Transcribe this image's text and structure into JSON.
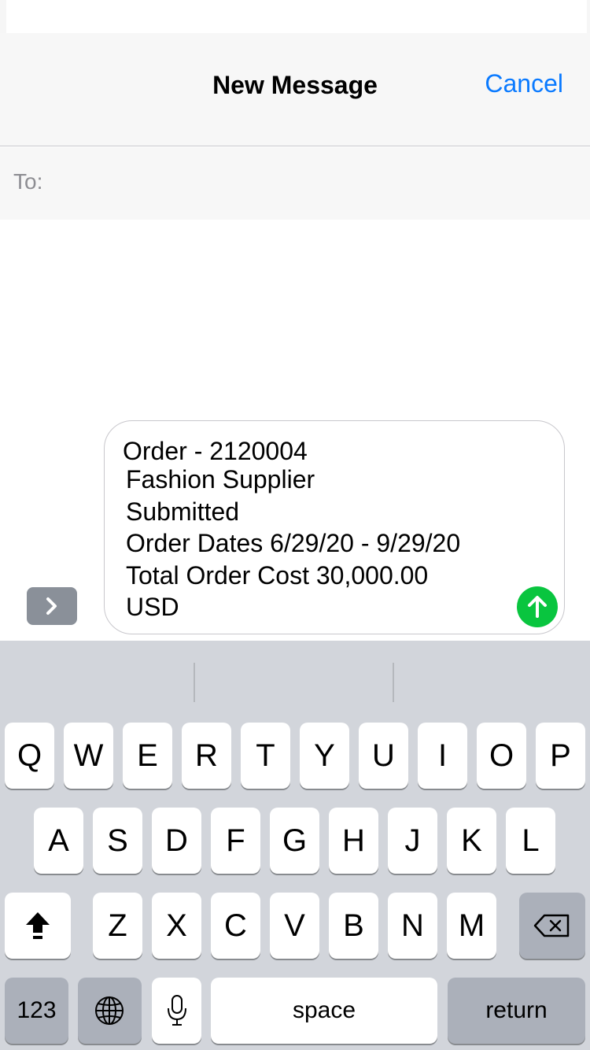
{
  "nav": {
    "title": "New Message",
    "cancel_label": "Cancel"
  },
  "to": {
    "label": "To:",
    "value": ""
  },
  "compose": {
    "lines": [
      "Order - 2120004",
      "Fashion Supplier",
      "Submitted",
      "Order Dates 6/29/20 - 9/29/20",
      "Total Order Cost 30,000.00",
      "USD"
    ]
  },
  "icons": {
    "expand": "chevron-right-icon",
    "send": "arrow-up-icon",
    "shift": "shift-arrow-icon",
    "delete": "backspace-icon",
    "globe": "globe-icon",
    "mic": "microphone-icon"
  },
  "colors": {
    "accent": "#0a7aff",
    "send": "#09c53f"
  },
  "keyboard": {
    "row1": [
      "Q",
      "W",
      "E",
      "R",
      "T",
      "Y",
      "U",
      "I",
      "O",
      "P"
    ],
    "row2": [
      "A",
      "S",
      "D",
      "F",
      "G",
      "H",
      "J",
      "K",
      "L"
    ],
    "row3": [
      "Z",
      "X",
      "C",
      "V",
      "B",
      "N",
      "M"
    ],
    "numbers_label": "123",
    "space_label": "space",
    "return_label": "return"
  }
}
